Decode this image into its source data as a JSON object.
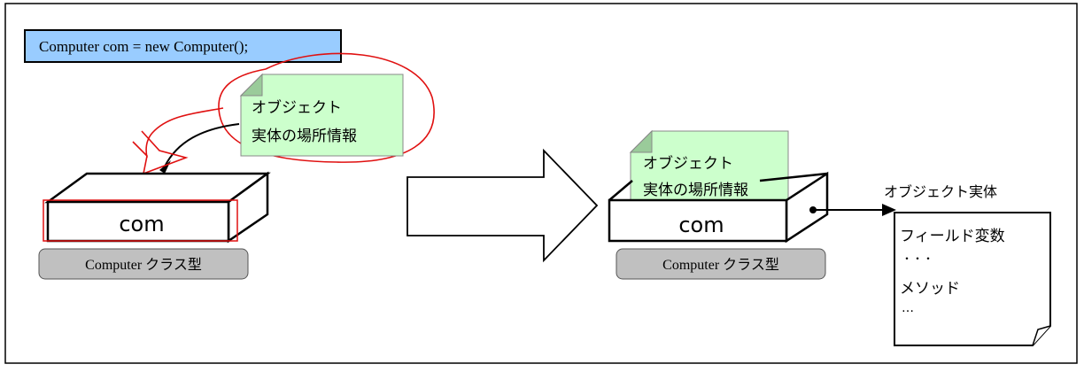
{
  "code_statement": "Computer com = new Computer();",
  "left": {
    "note_line1": "オブジェクト",
    "note_line2": "実体の場所情報",
    "variable_label": "com",
    "type_label": "Computer クラス型"
  },
  "right": {
    "note_line1": "オブジェクト",
    "note_line2": "実体の場所情報",
    "variable_label": "com",
    "type_label": "Computer クラス型",
    "object_title": "オブジェクト実体",
    "object_field_label": "フィールド変数",
    "object_field_ellipsis": "・・・",
    "object_method_label": "メソッド",
    "object_method_ellipsis": "…"
  },
  "colors": {
    "code_box_fill": "#99ccff",
    "note_fill": "#ccffcc",
    "type_box_fill": "#c0c0c0",
    "annotation_red": "#e01010",
    "outline": "#000000"
  }
}
